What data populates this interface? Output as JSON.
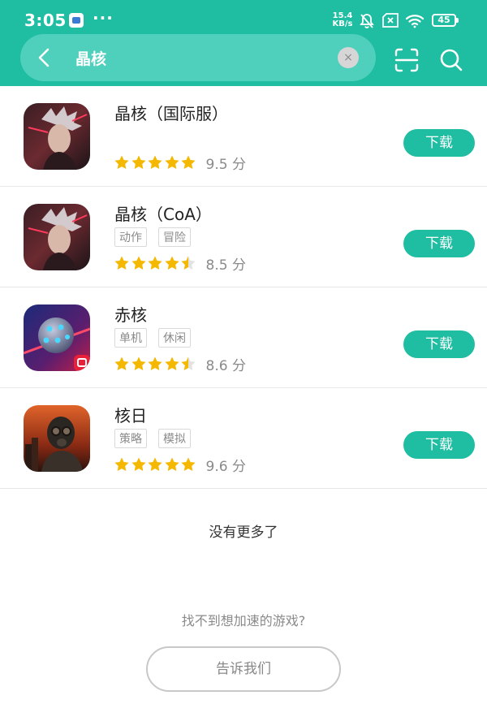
{
  "status_bar": {
    "time": "3:05",
    "more": "···",
    "net_speed_value": "15.4",
    "net_speed_unit": "KB/s",
    "battery": "45"
  },
  "search": {
    "query": "晶核",
    "clear_label": "×"
  },
  "results": [
    {
      "name": "晶核（国际服）",
      "tags": [],
      "rating": 5,
      "score": "9.5 分",
      "download": "下载",
      "icon": "crystal-core-icon"
    },
    {
      "name": "晶核（CoA）",
      "tags": [
        "动作",
        "冒险"
      ],
      "rating": 4.5,
      "score": "8.5 分",
      "download": "下载",
      "icon": "crystal-core-icon"
    },
    {
      "name": "赤核",
      "tags": [
        "单机",
        "休闲"
      ],
      "rating": 4.5,
      "score": "8.6 分",
      "download": "下载",
      "icon": "red-core-icon"
    },
    {
      "name": "核日",
      "tags": [
        "策略",
        "模拟"
      ],
      "rating": 5,
      "score": "9.6 分",
      "download": "下载",
      "icon": "nuclear-day-icon"
    }
  ],
  "footer": {
    "no_more": "没有更多了",
    "cant_find": "找不到想加速的游戏?",
    "tell_us": "告诉我们"
  },
  "colors": {
    "accent": "#1fbda2",
    "star": "#f5b800",
    "star_empty": "#e2e2e2"
  }
}
